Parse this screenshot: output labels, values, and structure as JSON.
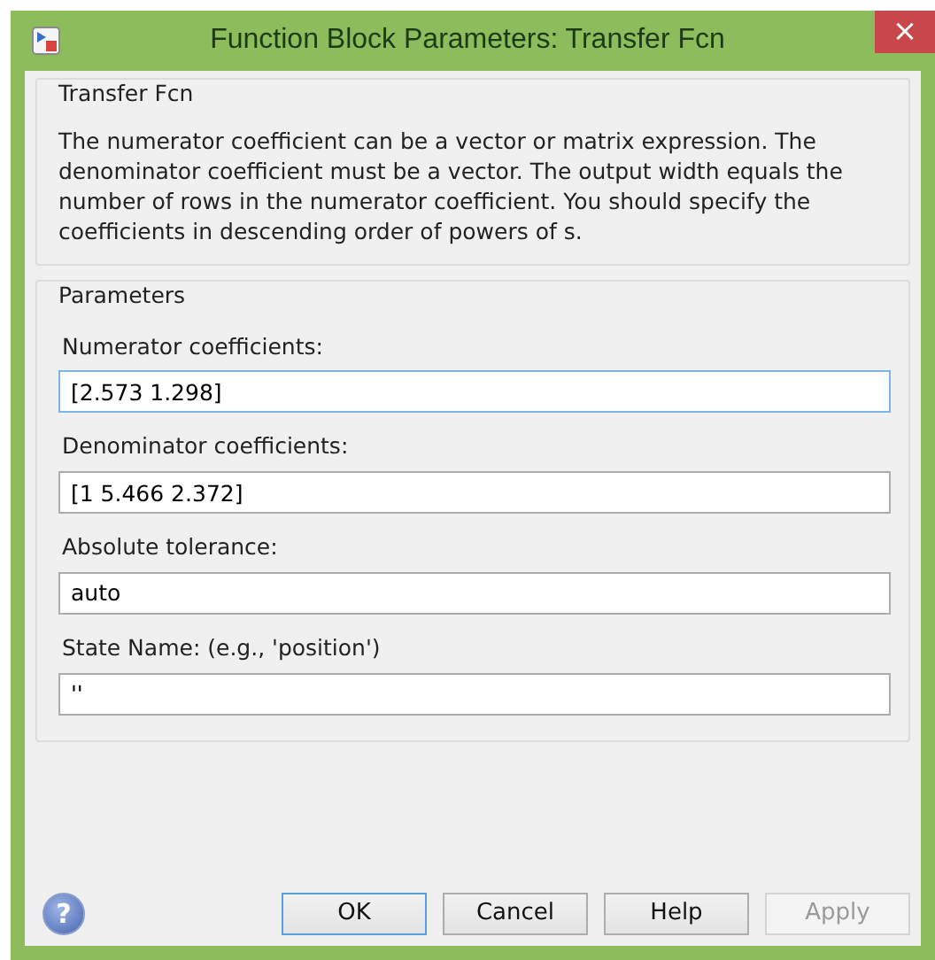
{
  "window": {
    "title": "Function Block Parameters: Transfer Fcn",
    "close": "×"
  },
  "description_group": {
    "title": "Transfer Fcn",
    "text": "The numerator coefficient can be a vector or matrix expression. The denominator coefficient must be a vector. The output width equals the number of rows in the numerator coefficient. You should specify the coefficients in descending order of powers of s."
  },
  "parameters_group": {
    "title": "Parameters",
    "fields": [
      {
        "label": "Numerator coefficients:",
        "value": "[2.573 1.298]",
        "focused": true
      },
      {
        "label": "Denominator coefficients:",
        "value": "[1 5.466 2.372]",
        "focused": false
      },
      {
        "label": "Absolute tolerance:",
        "value": "auto",
        "focused": false
      },
      {
        "label": "State Name: (e.g., 'position')",
        "value": "''",
        "focused": false
      }
    ]
  },
  "help_icon": "?",
  "buttons": [
    {
      "label": "OK",
      "default": true,
      "disabled": false
    },
    {
      "label": "Cancel",
      "default": false,
      "disabled": false
    },
    {
      "label": "Help",
      "default": false,
      "disabled": false
    },
    {
      "label": "Apply",
      "default": false,
      "disabled": true
    }
  ]
}
